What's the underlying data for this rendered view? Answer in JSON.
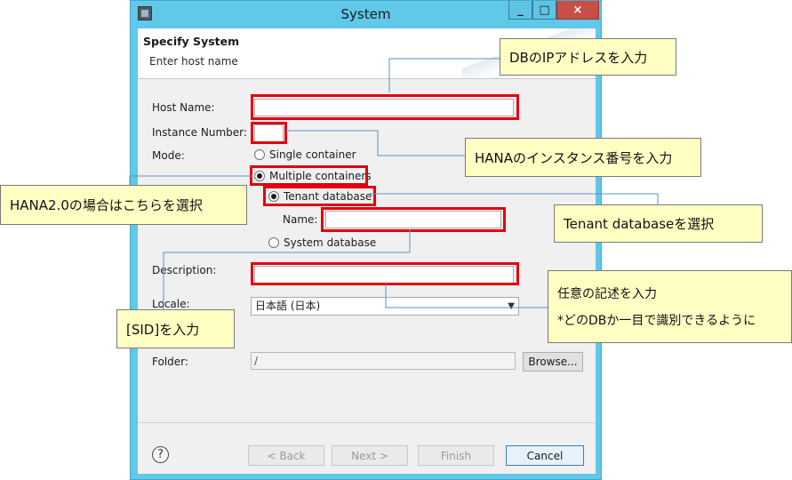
{
  "window": {
    "title": "System",
    "min_glyph": "_",
    "max_glyph": "□",
    "close_glyph": "×"
  },
  "header": {
    "title": "Specify System",
    "subtitle": "Enter host name"
  },
  "form": {
    "host_name_label": "Host Name:",
    "host_name_value": "",
    "instance_number_label": "Instance Number:",
    "instance_number_value": "",
    "mode_label": "Mode:",
    "mode_single": "Single container",
    "mode_multiple": "Multiple containers",
    "mode_selected": "Multiple containers",
    "tenant_option": "Tenant database",
    "name_label": "Name:",
    "name_value": "",
    "system_db_option": "System database",
    "description_label": "Description:",
    "description_value": "",
    "locale_label": "Locale:",
    "locale_value": "日本語 (日本)",
    "folder_label": "Folder:",
    "folder_value": "/",
    "browse_label": "Browse..."
  },
  "footer": {
    "help_glyph": "?",
    "back_label": "< Back",
    "next_label": "Next >",
    "finish_label": "Finish",
    "cancel_label": "Cancel"
  },
  "callouts": {
    "db_ip": "DBのIPアドレスを入力",
    "instance_no": "HANAのインスタンス番号を入力",
    "hana2": "HANA2.0の場合はこちらを選択",
    "tenant": "Tenant databaseを選択",
    "description_line1": "任意の記述を入力",
    "description_line2": "*どのDBか一目で識別できるように",
    "sid": "[SID]を入力"
  },
  "colors": {
    "titlebar": "#60c8e8",
    "close_button": "#c74f45",
    "highlight_box": "#e3000f",
    "callout_bg": "#ffffc4",
    "leader_line": "#5b8fc8"
  }
}
